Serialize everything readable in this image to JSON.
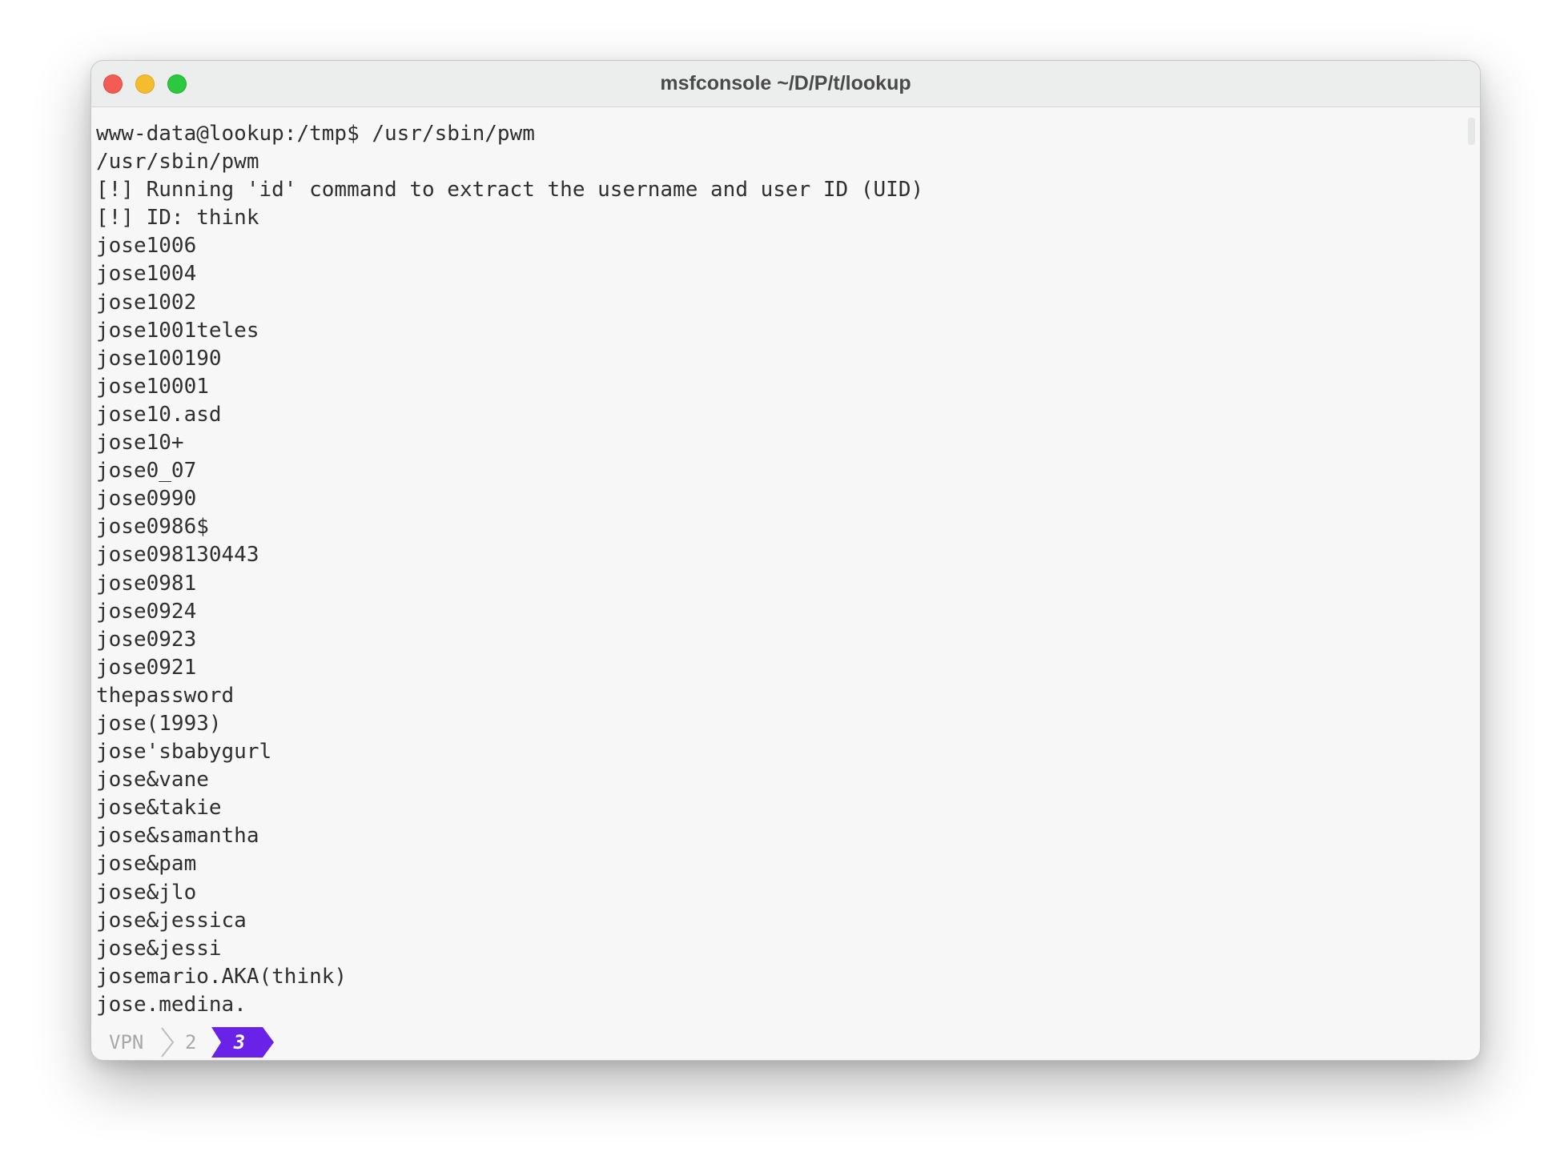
{
  "window": {
    "title": "msfconsole ~/D/P/t/lookup"
  },
  "terminal": {
    "lines": [
      "www-data@lookup:/tmp$ /usr/sbin/pwm",
      "/usr/sbin/pwm",
      "[!] Running 'id' command to extract the username and user ID (UID)",
      "[!] ID: think",
      "jose1006",
      "jose1004",
      "jose1002",
      "jose1001teles",
      "jose100190",
      "jose10001",
      "jose10.asd",
      "jose10+",
      "jose0_07",
      "jose0990",
      "jose0986$",
      "jose098130443",
      "jose0981",
      "jose0924",
      "jose0923",
      "jose0921",
      "thepassword",
      "jose(1993)",
      "jose'sbabygurl",
      "jose&vane",
      "jose&takie",
      "jose&samantha",
      "jose&pam",
      "jose&jlo",
      "jose&jessica",
      "jose&jessi",
      "josemario.AKA(think)",
      "jose.medina."
    ]
  },
  "statusbar": {
    "segment_1": "VPN",
    "segment_2": "2",
    "active_segment": "3",
    "active_color": "#6b22e8"
  },
  "colors": {
    "close": "#f25c54",
    "minimize": "#f6bc2f",
    "zoom": "#2cc840"
  }
}
